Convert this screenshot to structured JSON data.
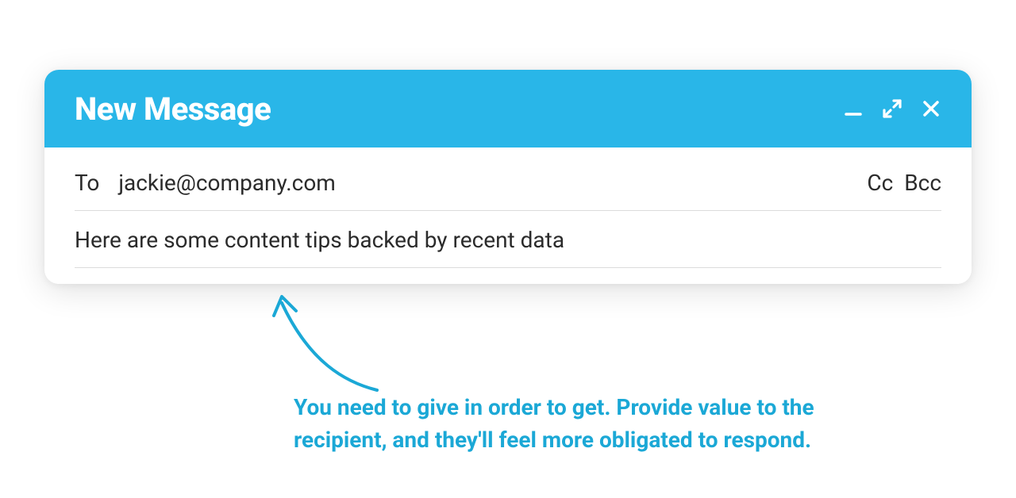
{
  "header": {
    "title": "New Message"
  },
  "to": {
    "label": "To",
    "value": "jackie@company.com",
    "cc": "Cc",
    "bcc": "Bcc"
  },
  "subject": {
    "value": "Here are some content tips backed by recent data"
  },
  "annotation": {
    "text": "You need to give in order to get. Provide value to the recipient, and they'll feel more obligated to respond."
  },
  "colors": {
    "accent": "#29b6e8",
    "annotation": "#1ba8d6"
  }
}
